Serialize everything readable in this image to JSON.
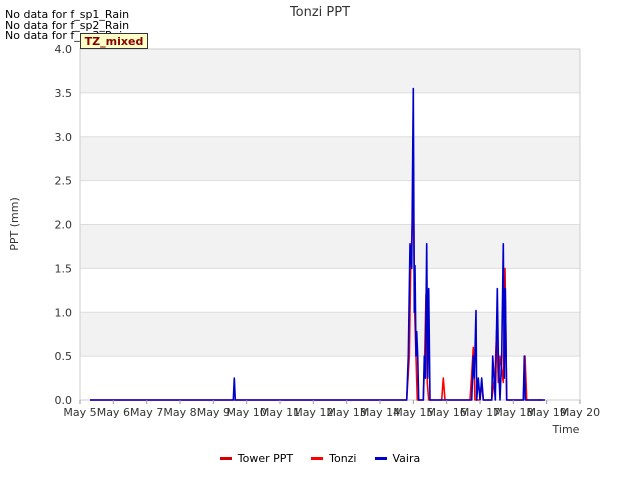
{
  "notes": [
    "No data for f_sp1_Rain",
    "No data for f_sp2_Rain",
    "No data for f_sp3_Rain"
  ],
  "badge": "TZ_mixed",
  "colors": {
    "tower": "#d40000",
    "tonzi": "#ff0000",
    "vaira": "#0000cc"
  },
  "chart_data": {
    "type": "line",
    "title": "Tonzi PPT",
    "xlabel": "Time",
    "ylabel": "PPT (mm)",
    "xlim": [
      5,
      20
    ],
    "ylim": [
      0,
      4.0
    ],
    "x_ticks": [
      5,
      6,
      7,
      8,
      9,
      10,
      11,
      12,
      13,
      14,
      15,
      16,
      17,
      18,
      19,
      20
    ],
    "x_tick_labels": [
      "May 5",
      "May 6",
      "May 7",
      "May 8",
      "May 9",
      "May 10",
      "May 11",
      "May 12",
      "May 13",
      "May 14",
      "May 15",
      "May 16",
      "May 17",
      "May 18",
      "May 19",
      "May 20"
    ],
    "y_ticks": [
      0.0,
      0.5,
      1.0,
      1.5,
      2.0,
      2.5,
      3.0,
      3.5,
      4.0
    ],
    "y_tick_labels": [
      "0.0",
      "0.5",
      "1.0",
      "1.5",
      "2.0",
      "2.5",
      "3.0",
      "3.5",
      "4.0"
    ],
    "series": [
      {
        "name": "Tower PPT",
        "color": "#d40000",
        "points": []
      },
      {
        "name": "Tonzi",
        "color": "#ff0000",
        "points": [
          [
            5.3,
            0
          ],
          [
            14.8,
            0
          ],
          [
            14.88,
            0.5
          ],
          [
            14.92,
            1.5
          ],
          [
            14.97,
            2.0
          ],
          [
            15.0,
            2.5
          ],
          [
            15.04,
            1.0
          ],
          [
            15.08,
            0.5
          ],
          [
            15.12,
            0.0
          ],
          [
            15.3,
            0
          ],
          [
            15.34,
            0.5
          ],
          [
            15.38,
            1.2
          ],
          [
            15.42,
            0.2
          ],
          [
            15.46,
            0
          ],
          [
            15.85,
            0
          ],
          [
            15.9,
            0.25
          ],
          [
            15.95,
            0
          ],
          [
            16.7,
            0
          ],
          [
            16.75,
            0.3
          ],
          [
            16.8,
            0.6
          ],
          [
            16.85,
            0
          ],
          [
            17.0,
            0
          ],
          [
            17.05,
            0.2
          ],
          [
            17.1,
            0
          ],
          [
            17.35,
            0
          ],
          [
            17.45,
            0.3
          ],
          [
            17.5,
            0.8
          ],
          [
            17.55,
            0.2
          ],
          [
            17.6,
            0.5
          ],
          [
            17.7,
            0.2
          ],
          [
            17.75,
            1.5
          ],
          [
            17.8,
            0
          ],
          [
            18.3,
            0
          ],
          [
            18.35,
            0.5
          ],
          [
            18.4,
            0
          ],
          [
            18.9,
            0
          ]
        ]
      },
      {
        "name": "Vaira",
        "color": "#0000cc",
        "points": [
          [
            5.3,
            0
          ],
          [
            9.6,
            0
          ],
          [
            9.63,
            0.25
          ],
          [
            9.66,
            0
          ],
          [
            14.8,
            0
          ],
          [
            14.85,
            0.5
          ],
          [
            14.9,
            1.78
          ],
          [
            14.95,
            1.5
          ],
          [
            14.98,
            2.78
          ],
          [
            15.0,
            3.55
          ],
          [
            15.03,
            1.0
          ],
          [
            15.05,
            1.53
          ],
          [
            15.08,
            0.5
          ],
          [
            15.1,
            0.78
          ],
          [
            15.13,
            0.5
          ],
          [
            15.16,
            0
          ],
          [
            15.3,
            0
          ],
          [
            15.33,
            0.5
          ],
          [
            15.36,
            0.25
          ],
          [
            15.4,
            1.78
          ],
          [
            15.43,
            0.25
          ],
          [
            15.46,
            1.27
          ],
          [
            15.5,
            0
          ],
          [
            16.75,
            0
          ],
          [
            16.8,
            0.5
          ],
          [
            16.83,
            0.25
          ],
          [
            16.88,
            1.02
          ],
          [
            16.9,
            0
          ],
          [
            16.95,
            0.25
          ],
          [
            17.0,
            0
          ],
          [
            17.05,
            0.25
          ],
          [
            17.1,
            0
          ],
          [
            17.35,
            0
          ],
          [
            17.38,
            0.5
          ],
          [
            17.42,
            0.25
          ],
          [
            17.46,
            0
          ],
          [
            17.52,
            1.27
          ],
          [
            17.55,
            0.5
          ],
          [
            17.6,
            0
          ],
          [
            17.65,
            0.5
          ],
          [
            17.7,
            1.78
          ],
          [
            17.73,
            0.25
          ],
          [
            17.76,
            1.27
          ],
          [
            17.8,
            0
          ],
          [
            18.3,
            0
          ],
          [
            18.33,
            0.5
          ],
          [
            18.36,
            0
          ],
          [
            18.95,
            0
          ]
        ]
      }
    ]
  }
}
